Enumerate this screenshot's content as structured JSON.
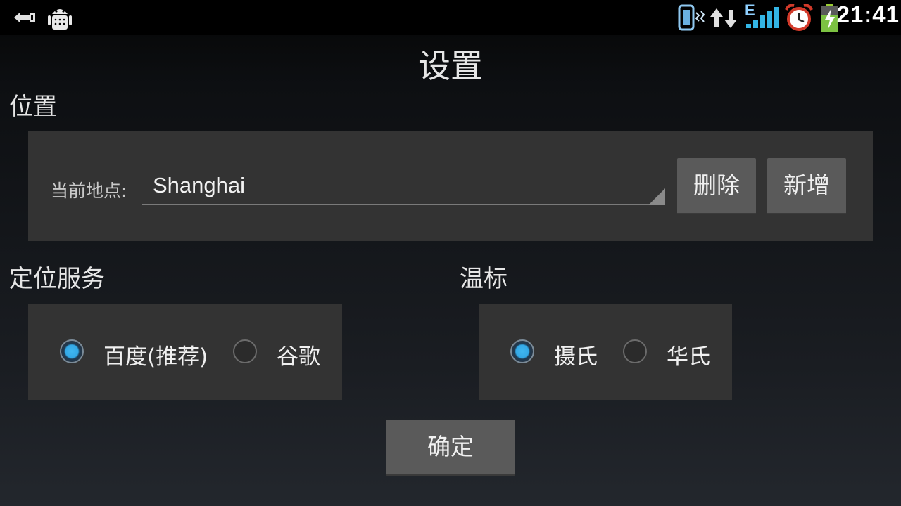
{
  "status_bar": {
    "time": "21:41",
    "network": "E",
    "icons": [
      "usb-icon",
      "android-debug-icon",
      "vibrate-icon",
      "data-activity-icon",
      "signal-icon",
      "alarm-icon",
      "battery-charging-icon"
    ]
  },
  "page": {
    "title": "设置"
  },
  "location": {
    "section_label": "位置",
    "current_label": "当前地点:",
    "current_value": "Shanghai",
    "delete_label": "删除",
    "add_label": "新增"
  },
  "location_service": {
    "section_label": "定位服务",
    "options": [
      {
        "label": "百度(推荐)",
        "selected": true
      },
      {
        "label": "谷歌",
        "selected": false
      }
    ]
  },
  "temperature_unit": {
    "section_label": "温标",
    "options": [
      {
        "label": "摄氏",
        "selected": true
      },
      {
        "label": "华氏",
        "selected": false
      }
    ]
  },
  "confirm_label": "确定",
  "colors": {
    "accent": "#33b5e5",
    "panel": "#333333",
    "button": "#5a5a5a"
  }
}
